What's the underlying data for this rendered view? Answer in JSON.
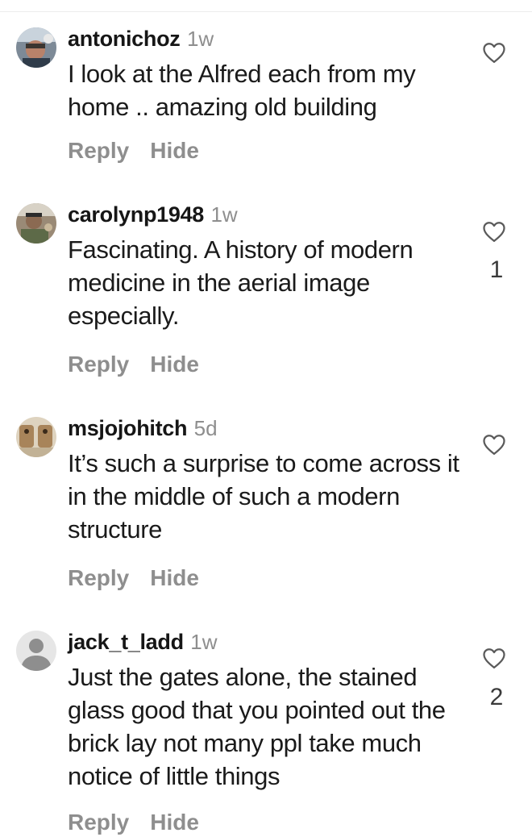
{
  "comments": [
    {
      "username": "antonichoz",
      "time": "1w",
      "text": "I look at the Alfred each from my home .. amazing old building",
      "like_count": "",
      "reply_label": "Reply",
      "hide_label": "Hide"
    },
    {
      "username": "carolynp1948",
      "time": "1w",
      "text": "Fascinating. A history of modern medicine in the aerial image especially.",
      "like_count": "1",
      "reply_label": "Reply",
      "hide_label": "Hide"
    },
    {
      "username": "msjojohitch",
      "time": "5d",
      "text": "It’s such a surprise to come across it in the middle of such a modern structure",
      "like_count": "",
      "reply_label": "Reply",
      "hide_label": "Hide"
    },
    {
      "username": "jack_t_ladd",
      "time": "1w",
      "text": "Just the gates alone, the stained glass good that you pointed out the brick lay not many ppl take much notice of little things",
      "like_count": "2",
      "reply_label": "Reply",
      "hide_label": "Hide"
    }
  ],
  "icons": {
    "like": "heart-outline-icon",
    "default_avatar": "person-silhouette-icon"
  },
  "colors": {
    "username": "#161616",
    "secondary_text": "#8e8e8e",
    "body_text": "#1a1a1a",
    "divider": "#ececec"
  }
}
